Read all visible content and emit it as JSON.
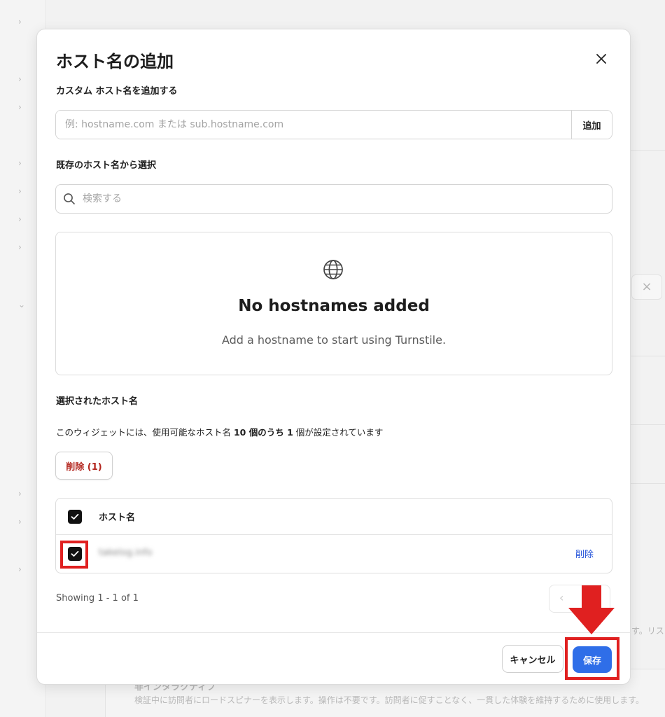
{
  "background": {
    "side_text": "す。リスク",
    "bottom_title": "非インタラクティブ",
    "bottom_desc": "検証中に訪問者にロードスピナーを表示します。操作は不要です。訪問者に促すことなく、一貫した体験を維持するために使用します。",
    "close_icon": "×"
  },
  "modal": {
    "title": "ホスト名の追加",
    "close_icon": "close-icon",
    "custom_label": "カスタム ホスト名を追加する",
    "add_input": {
      "placeholder": "例: hostname.com または sub.hostname.com",
      "value": ""
    },
    "add_button": "追加",
    "existing_label": "既存のホスト名から選択",
    "search": {
      "placeholder": "検索する",
      "value": ""
    },
    "empty_state": {
      "icon": "globe-icon",
      "title": "No hostnames added",
      "description": "Add a hostname to start using Turnstile."
    },
    "selected_label": "選択されたホスト名",
    "count_text": {
      "prefix": "このウィジェットには、使用可能なホスト名 ",
      "bold1": "10 個のうち 1",
      "suffix": " 個が設定されています"
    },
    "delete_selected_button": "削除 (1)",
    "table": {
      "header": "ホスト名",
      "header_checked": true,
      "rows": [
        {
          "hostname": "takelog.info",
          "checked": true,
          "action": "削除"
        }
      ]
    },
    "pagination": {
      "showing": "Showing 1 - 1 of 1"
    },
    "footer": {
      "cancel": "キャンセル",
      "save": "保存"
    }
  },
  "colors": {
    "primary": "#2f6ee8",
    "danger_text": "#b3261e",
    "link": "#1d4ed8",
    "highlight": "#e02020"
  }
}
